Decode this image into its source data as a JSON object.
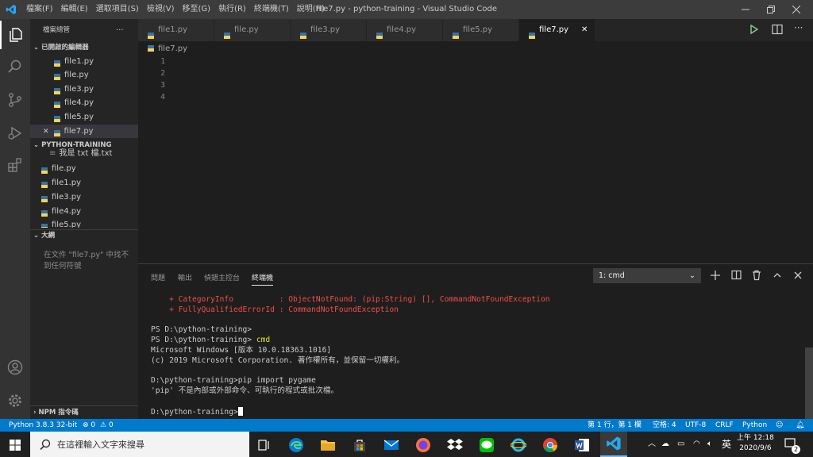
{
  "titlebar": {
    "menus": [
      "檔案(F)",
      "編輯(E)",
      "選取項目(S)",
      "檢視(V)",
      "移至(G)",
      "執行(R)",
      "終端機(T)",
      "說明(H)"
    ],
    "title": "file7.py - python-training - Visual Studio Code"
  },
  "sidebar": {
    "header": "檔案總管",
    "more": "···",
    "open_editors_title": "已開啟的編輯器",
    "open_editors": [
      "file1.py",
      "file.py",
      "file3.py",
      "file4.py",
      "file5.py",
      "file7.py"
    ],
    "close_glyph": "✕",
    "project_title": "PYTHON-TRAINING",
    "project_files": [
      "我是 txt 檔.txt",
      "file.py",
      "file1.py",
      "file3.py",
      "file4.py",
      "file5.py"
    ],
    "outline_title": "大綱",
    "outline_message": "在文件 \"file7.py\" 中找不到任何符號",
    "npm_title": "NPM 指令碼"
  },
  "tabs": [
    "file1.py",
    "file.py",
    "file3.py",
    "file4.py",
    "file5.py",
    "file7.py"
  ],
  "tab_close": "✕",
  "editor": {
    "breadcrumb": "file7.py",
    "line_numbers": [
      "1",
      "2",
      "3",
      "4"
    ]
  },
  "panel": {
    "tabs": [
      "問題",
      "輸出",
      "偵錯主控台",
      "終端機"
    ],
    "terminal_select": "1: cmd",
    "lines": [
      "    + CategoryInfo          : ObjectNotFound: (pip:String) [], CommandNotFoundException",
      "    + FullyQualifiedErrorId : CommandNotFoundException",
      "",
      "PS D:\\python-training>",
      "PS D:\\python-training> ",
      "Microsoft Windows [版本 10.0.18363.1016]",
      "(c) 2019 Microsoft Corporation. 著作權所有，並保留一切權利。",
      "",
      "D:\\python-training>pip import pygame",
      "'pip' 不是內部或外部命令、可執行的程式或批次檔。",
      "",
      "D:\\python-training>"
    ],
    "cmd_word": "cmd"
  },
  "statusbar": {
    "python": "Python 3.8.3 32-bit",
    "errors": "0",
    "warnings": "0",
    "position": "第 1 行，第 1 欄",
    "spaces": "空格: 4",
    "encoding": "UTF-8",
    "eol": "CRLF",
    "language": "Python"
  },
  "taskbar": {
    "search_placeholder": "在這裡輸入文字來搜尋",
    "ime": "英",
    "time": "上午 12:18",
    "date": "2020/9/6",
    "notification_count": "2"
  },
  "colors": {
    "accent": "#007acc",
    "error_text": "#f14c4c",
    "yellow_text": "#e5e510",
    "python_blue": "#3572a5",
    "python_yellow": "#f7d44b"
  }
}
